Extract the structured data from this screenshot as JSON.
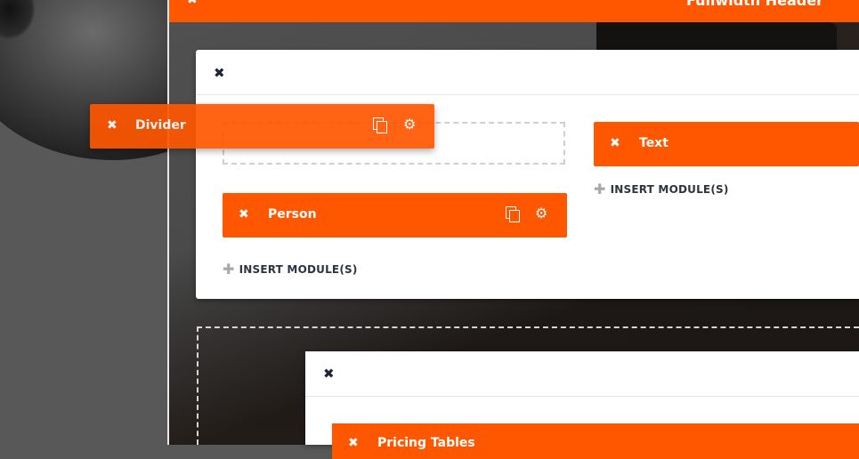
{
  "header": {
    "close_icon": "✖",
    "title": "Fullwidth Header"
  },
  "row": {
    "close_icon": "✖"
  },
  "left_column": {
    "modules": [
      {
        "close_icon": "✖",
        "label": "Person"
      }
    ],
    "insert_label": "INSERT MODULE(S)"
  },
  "right_column": {
    "modules": [
      {
        "close_icon": "✖",
        "label": "Text"
      }
    ],
    "insert_label": "INSERT MODULE(S)"
  },
  "dragging_module": {
    "close_icon": "✖",
    "label": "Divider"
  },
  "lower_row": {
    "close_icon": "✖",
    "module": {
      "close_icon": "✖",
      "label": "Pricing Tables"
    }
  },
  "icons": {
    "plus": "✚",
    "gear": "⚙"
  },
  "colors": {
    "accent": "#ff5600",
    "text_dark": "#1b2533"
  }
}
